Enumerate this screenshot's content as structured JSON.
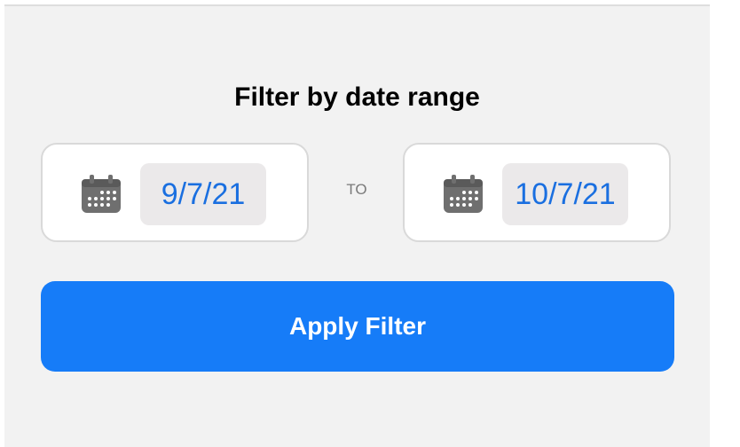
{
  "filter": {
    "title": "Filter by date range",
    "start_date": "9/7/21",
    "separator": "TO",
    "end_date": "10/7/21",
    "apply_label": "Apply Filter"
  },
  "colors": {
    "accent": "#167cf8",
    "date_text": "#1a6fe0",
    "icon": "#6f6f6f"
  },
  "icons": {
    "date_picker": "calendar-icon"
  }
}
